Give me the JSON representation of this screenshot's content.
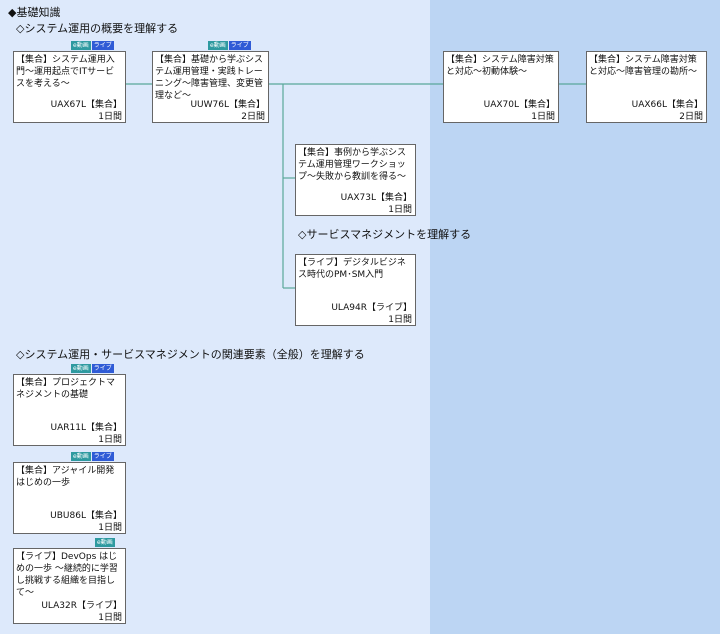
{
  "section_title": "◆基礎知識",
  "headings": {
    "overview": "◇システム運用の概要を理解する",
    "service_mgmt": "◇サービスマネジメントを理解する",
    "related": "◇システム運用・サービスマネジメントの関連要素（全般）を理解する"
  },
  "badges": {
    "edouga": "e動画",
    "live": "ライブ"
  },
  "colors": {
    "left_panel": "#dde9fb",
    "right_panel": "#bcd5f3",
    "connector": "#5aa89a",
    "badge_edouga": "#2e9aa0",
    "badge_live": "#2f5bd6"
  },
  "courses": [
    {
      "id": "uax67l",
      "title": "【集合】システム運用入門〜運用起点でITサービスを考える〜",
      "code": "UAX67L【集合】",
      "duration": "1日間",
      "badges": [
        "edouga",
        "live"
      ]
    },
    {
      "id": "uuw76l",
      "title": "【集合】基礎から学ぶシステム運用管理・実践トレーニング〜障害管理、変更管理など〜",
      "code": "UUW76L【集合】",
      "duration": "2日間",
      "badges": [
        "edouga",
        "live"
      ]
    },
    {
      "id": "uax70l",
      "title": "【集合】システム障害対策と対応〜初動体験〜",
      "code": "UAX70L【集合】",
      "duration": "1日間",
      "badges": []
    },
    {
      "id": "uax66l",
      "title": "【集合】システム障害対策と対応〜障害管理の勘所〜",
      "code": "UAX66L【集合】",
      "duration": "2日間",
      "badges": []
    },
    {
      "id": "uax73l",
      "title": "【集合】事例から学ぶシステム運用管理ワークショップ〜失敗から教訓を得る〜",
      "code": "UAX73L【集合】",
      "duration": "1日間",
      "badges": []
    },
    {
      "id": "ula94r",
      "title": "【ライブ】デジタルビジネス時代のPM･SM入門",
      "code": "ULA94R【ライブ】",
      "duration": "1日間",
      "badges": []
    },
    {
      "id": "uar11l",
      "title": "【集合】プロジェクトマネジメントの基礎",
      "code": "UAR11L【集合】",
      "duration": "1日間",
      "badges": [
        "edouga",
        "live"
      ]
    },
    {
      "id": "ubu86l",
      "title": "【集合】アジャイル開発はじめの一歩",
      "code": "UBU86L【集合】",
      "duration": "1日間",
      "badges": [
        "edouga",
        "live"
      ]
    },
    {
      "id": "ula32r",
      "title": "【ライブ】DevOps はじめの一歩 〜継続的に学習し挑戦する組織を目指して〜",
      "code": "ULA32R【ライブ】",
      "duration": "1日間",
      "badges": [
        "edouga"
      ]
    }
  ]
}
